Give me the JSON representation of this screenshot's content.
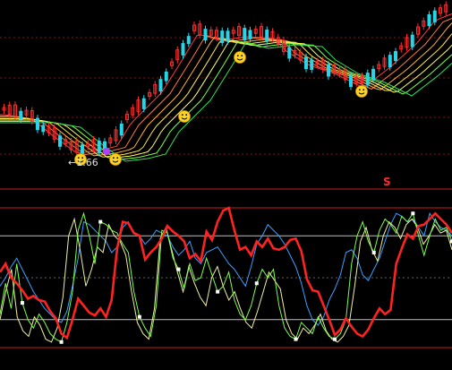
{
  "chart_data": {
    "type": "line",
    "panels": [
      {
        "name": "price",
        "candles": {
          "count": 80,
          "up_color": "#ff2a2a",
          "down_color": "#28d4e8"
        },
        "moving_average_colors": [
          "#ff3b3b",
          "#ff7a3b",
          "#ffb23b",
          "#ffe94a",
          "#ffff66",
          "#7dff4a",
          "#2fe05a"
        ],
        "grid": true,
        "low_value": "1.66",
        "smiley_markers": 5
      },
      {
        "name": "oscillator",
        "series": [
          {
            "color": "#ff2222",
            "values": [
              54,
              60,
              50,
              46,
              41,
              35,
              37,
              34,
              33,
              26,
              21,
              10,
              7,
              20,
              35,
              30,
              25,
              23,
              28,
              22,
              34,
              71,
              90,
              89,
              82,
              80,
              63,
              68,
              72,
              78,
              87,
              83,
              80,
              76,
              64,
              67,
              62,
              83,
              77,
              90,
              98,
              100,
              84,
              70,
              72,
              66,
              76,
              72,
              78,
              71,
              70,
              72,
              77,
              78,
              69,
              49,
              41,
              40,
              30,
              20,
              9,
              13,
              21,
              15,
              10,
              8,
              13,
              21,
              28,
              24,
              27,
              60,
              71,
              81,
              78,
              87,
              88,
              92,
              96,
              92,
              88,
              82
            ]
          },
          {
            "color": "#3aa0ff",
            "values": [
              44,
              50,
              58,
              64,
              56,
              48,
              40,
              34,
              28,
              24,
              20,
              18,
              26,
              44,
              64,
              90,
              88,
              84,
              80,
              76,
              68,
              72,
              86,
              90,
              82,
              80,
              74,
              78,
              84,
              82,
              80,
              72,
              66,
              70,
              76,
              64,
              60,
              68,
              70,
              72,
              66,
              60,
              56,
              50,
              44,
              58,
              74,
              80,
              88,
              84,
              80,
              74,
              66,
              58,
              46,
              30,
              20,
              16,
              22,
              34,
              42,
              52,
              68,
              70,
              64,
              52,
              48,
              56,
              64,
              76,
              88,
              96,
              94,
              90,
              92,
              86,
              80,
              96,
              90,
              86,
              84,
              80
            ]
          },
          {
            "color": "#7dff4a",
            "values": [
              24,
              46,
              28,
              60,
              32,
              20,
              14,
              24,
              18,
              10,
              6,
              4,
              18,
              40,
              84,
              96,
              80,
              60,
              90,
              88,
              84,
              82,
              74,
              68,
              40,
              22,
              14,
              8,
              30,
              84,
              82,
              64,
              56,
              42,
              60,
              48,
              50,
              64,
              52,
              40,
              44,
              54,
              34,
              24,
              20,
              30,
              46,
              56,
              50,
              56,
              30,
              14,
              8,
              6,
              18,
              14,
              10,
              22,
              14,
              8,
              6,
              10,
              20,
              60,
              80,
              90,
              76,
              68,
              84,
              92,
              88,
              82,
              94,
              90,
              96,
              80,
              66,
              80,
              92,
              84,
              86,
              76
            ]
          },
          {
            "color": "#f0f0a0",
            "values": [
              20,
              40,
              56,
              22,
              12,
              8,
              22,
              16,
              6,
              4,
              14,
              36,
              80,
              92,
              70,
              44,
              56,
              72,
              68,
              88,
              80,
              76,
              66,
              40,
              18,
              10,
              6,
              28,
              78,
              86,
              70,
              54,
              40,
              58,
              46,
              36,
              30,
              50,
              58,
              44,
              34,
              40,
              28,
              18,
              14,
              26,
              40,
              54,
              48,
              42,
              20,
              10,
              6,
              14,
              10,
              16,
              24,
              12,
              6,
              4,
              8,
              16,
              44,
              76,
              86,
              70,
              62,
              80,
              90,
              86,
              78,
              88,
              92,
              86,
              74,
              80,
              88,
              82,
              84,
              70
            ]
          }
        ],
        "ylim": [
          0,
          100
        ],
        "reference_lines": [
          0,
          20,
          50,
          80,
          100
        ],
        "signal_marker": "S"
      }
    ]
  }
}
